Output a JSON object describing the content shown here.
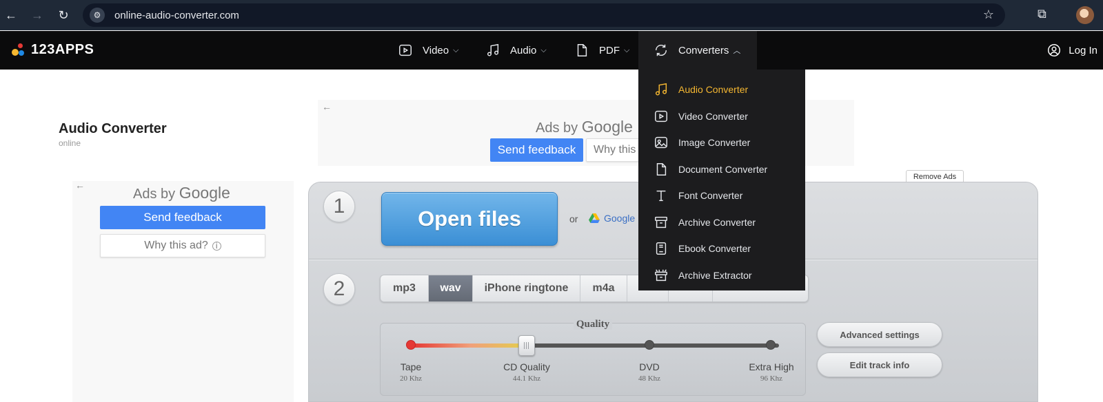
{
  "browser": {
    "url": "online-audio-converter.com"
  },
  "header": {
    "logo_text": "123APPS",
    "nav": [
      {
        "label": "Video",
        "icon": "video-icon"
      },
      {
        "label": "Audio",
        "icon": "music-note-icon"
      },
      {
        "label": "PDF",
        "icon": "document-icon"
      },
      {
        "label": "Converters",
        "icon": "convert-icon",
        "expanded": true
      }
    ],
    "login_label": "Log In"
  },
  "converters_menu": {
    "items": [
      {
        "label": "Audio Converter",
        "icon": "music-note-icon",
        "active": true
      },
      {
        "label": "Video Converter",
        "icon": "video-icon"
      },
      {
        "label": "Image Converter",
        "icon": "image-icon"
      },
      {
        "label": "Document Converter",
        "icon": "document-icon"
      },
      {
        "label": "Font Converter",
        "icon": "font-icon"
      },
      {
        "label": "Archive Converter",
        "icon": "archive-icon"
      },
      {
        "label": "Ebook Converter",
        "icon": "ebook-icon"
      },
      {
        "label": "Archive Extractor",
        "icon": "archive-extractor-icon"
      }
    ],
    "active_color": "#f5b731"
  },
  "page": {
    "title": "Audio Converter",
    "subtitle": "online"
  },
  "ads": {
    "top": {
      "ads_by": "Ads by",
      "google": "Google",
      "feedback": "Send feedback",
      "why": "Why this"
    },
    "left": {
      "ads_by": "Ads by",
      "google": "Google",
      "feedback": "Send feedback",
      "why": "Why this ad?"
    },
    "remove_ads": "Remove Ads"
  },
  "converter": {
    "step1": {
      "number": "1",
      "open_files": "Open files",
      "or": "or",
      "gdrive_label": "Google D"
    },
    "step2": {
      "number": "2",
      "formats": [
        "mp3",
        "wav",
        "iPhone ringtone",
        "m4a"
      ],
      "selected_format": "wav",
      "quality_label": "Quality",
      "quality_levels": [
        {
          "name": "Tape",
          "rate": "20 Khz"
        },
        {
          "name": "CD Quality",
          "rate": "44.1 Khz"
        },
        {
          "name": "DVD",
          "rate": "48 Khz"
        },
        {
          "name": "Extra High",
          "rate": "96 Khz"
        }
      ],
      "selected_quality": "CD Quality",
      "advanced_settings": "Advanced settings",
      "edit_track_info": "Edit track info"
    }
  },
  "colors": {
    "chrome_bg": "#1f2937",
    "appbar_bg": "#0b0b0c",
    "open_files_blue": "#3b8fd5",
    "google_blue": "#4285f4"
  }
}
